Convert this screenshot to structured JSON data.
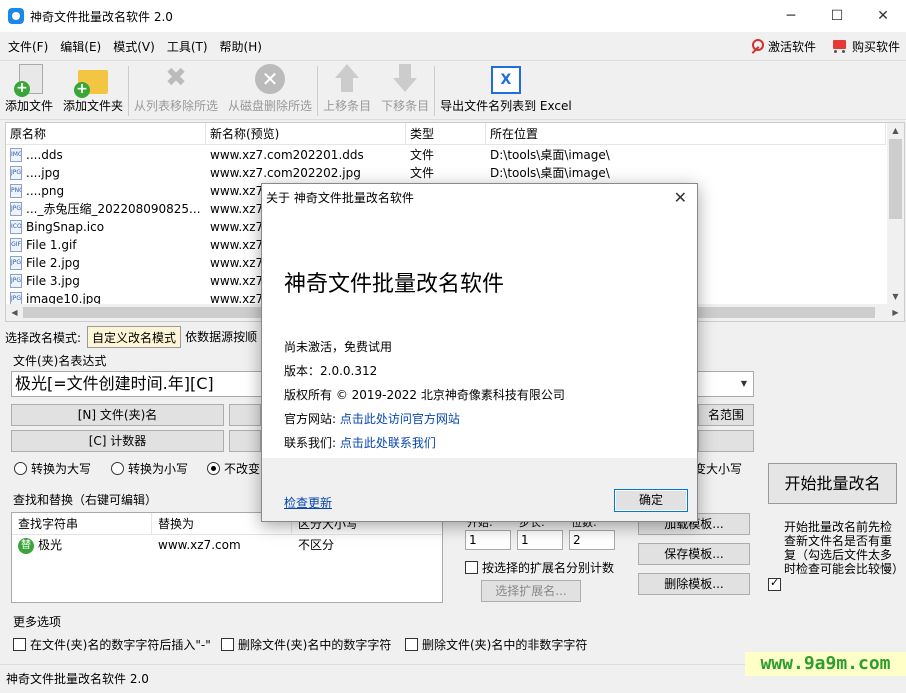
{
  "window": {
    "title": "神奇文件批量改名软件 2.0",
    "controls": [
      "─",
      "☐",
      "✕"
    ]
  },
  "menu": {
    "items": [
      "文件(F)",
      "编辑(E)",
      "模式(V)",
      "工具(T)",
      "帮助(H)"
    ],
    "activate_label": "激活软件",
    "buy_label": "购买软件"
  },
  "toolbar": {
    "add_file": "添加文件",
    "add_folder": "添加文件夹",
    "remove_from_list": "从列表移除所选",
    "delete_from_disk": "从磁盘删除所选",
    "move_up": "上移条目",
    "move_down": "下移条目",
    "export_excel": "导出文件名列表到 Excel"
  },
  "filelist": {
    "headers": [
      "原名称",
      "新名称(预览)",
      "类型",
      "所在位置"
    ],
    "rows": [
      {
        "icon": "IMG",
        "name": "....dds",
        "newname": "www.xz7.com202201.dds",
        "type": "文件",
        "path": "D:\\tools\\桌面\\image\\"
      },
      {
        "icon": "JPG",
        "name": "....jpg",
        "newname": "www.xz7.com202202.jpg",
        "type": "文件",
        "path": "D:\\tools\\桌面\\image\\"
      },
      {
        "icon": "PNG",
        "name": "....png",
        "newname": "www.xz7",
        "type": "",
        "path": ""
      },
      {
        "icon": "JPG",
        "name": "..._赤兔压缩_202208090825...",
        "newname": "www.xz7",
        "type": "",
        "path": ""
      },
      {
        "icon": "ICO",
        "name": "BingSnap.ico",
        "newname": "www.xz7",
        "type": "",
        "path": ""
      },
      {
        "icon": "GIF",
        "name": "File 1.gif",
        "newname": "www.xz7",
        "type": "",
        "path": ""
      },
      {
        "icon": "JPG",
        "name": "File 2.jpg",
        "newname": "www.xz7",
        "type": "",
        "path": ""
      },
      {
        "icon": "JPG",
        "name": "File 3.jpg",
        "newname": "www.xz7",
        "type": "",
        "path": ""
      },
      {
        "icon": "JPG",
        "name": "image10.jpg",
        "newname": "www.xz7",
        "type": "",
        "path": ""
      }
    ]
  },
  "mode": {
    "label": "选择改名模式:",
    "tabs": [
      "自定义改名模式",
      "依数据源按顺"
    ]
  },
  "expression": {
    "group_title": "文件(夹)名表达式",
    "value": "极光[=文件创建时间.年][C]",
    "btn_name": "[N] 文件(夹)名",
    "btn_counter": "[C] 计数器",
    "btn_range": "名范围",
    "radio_upper": "转换为大写",
    "radio_lower": "转换为小写",
    "radio_keep": "不改变",
    "radio_right": "变大小写"
  },
  "find_replace": {
    "group_title": "查找和替换（右键可编辑）",
    "headers": [
      "查找字符串",
      "替换为",
      "区分大小写"
    ],
    "rows": [
      {
        "icon": "替",
        "find": "极光",
        "replace": "www.xz7.com",
        "case": "不区分"
      }
    ]
  },
  "counter": {
    "labels": [
      "开始:",
      "步长:",
      "位数:"
    ],
    "values": [
      "1",
      "1",
      "2"
    ],
    "ext_count": "按选择的扩展名分别计数",
    "select_ext": "选择扩展名..."
  },
  "templates": {
    "load": "加载模板...",
    "save": "保存模板...",
    "delete": "删除模板..."
  },
  "start": {
    "button": "开始批量改名",
    "note": "开始批量改名前先检查新文件名是否有重复（勾选后文件太多时检查可能会比较慢）"
  },
  "more": {
    "group_title": "更多选项",
    "opt1": "在文件(夹)名的数字字符后插入\"-\"",
    "opt2": "删除文件(夹)名中的数字字符",
    "opt3": "删除文件(夹)名中的非数字字符"
  },
  "status": {
    "text": "神奇文件批量改名软件 2.0"
  },
  "watermark": "www.9a9m.com",
  "dialog": {
    "title": "关于 神奇文件批量改名软件",
    "app_name": "神奇文件批量改名软件",
    "activation": "尚未激活，免费试用",
    "version": "版本：2.0.0.312",
    "copyright": "版权所有 © 2019-2022 北京神奇像素科技有限公司",
    "site_label": "官方网站:",
    "site_link": "点击此处访问官方网站",
    "contact_label": "联系我们:",
    "contact_link": "点击此处联系我们",
    "check_update": "检查更新",
    "ok": "确定"
  }
}
